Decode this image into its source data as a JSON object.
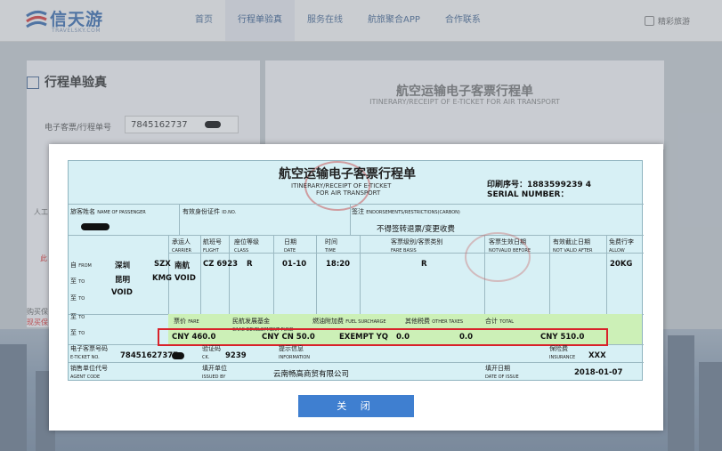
{
  "header": {
    "logo_text": "信天游",
    "logo_sub": "TRAVELSKY.COM",
    "nav": [
      "首页",
      "行程单验真",
      "服务在线",
      "航旅聚合APP",
      "合作联系"
    ],
    "active_nav_index": 1,
    "home_link": "精彩旅游"
  },
  "left_panel": {
    "title": "行程单验真",
    "ticket_label": "电子客票/行程单号",
    "ticket_value": "7845162737",
    "side1": "人工",
    "side2": "此",
    "side3": "购买保",
    "side4": "现买保"
  },
  "right_panel": {
    "title": "航空运输电子客票行程单",
    "subtitle": "ITINERARY/RECEIPT OF E-TICKET FOR AIR TRANSPORT"
  },
  "ticket": {
    "title": "航空运输电子客票行程单",
    "subtitle1": "ITINERARY/RECEIPT OF E-TICKET",
    "subtitle2": "FOR AIR TRANSPORT",
    "print_no": "印刷序号：1883599239    4",
    "serial_no": "SERIAL NUMBER：",
    "passenger_label": "旅客姓名",
    "passenger_label_en": "NAME OF PASSENGER",
    "id_label": "有效身份证件",
    "id_label_en": "ID.NO.",
    "endorse_label": "签注",
    "endorse_label_en": "ENDORSEMENTS/RESTRICTIONS(CARBON)",
    "endorse_value": "不得签转退票/变更收费",
    "headers": {
      "carrier": "承运人",
      "carrier_en": "CARRIER",
      "flight": "航班号",
      "flight_en": "FLIGHT",
      "class": "座位等级",
      "class_en": "CLASS",
      "date": "日期",
      "date_en": "DATE",
      "time": "时间",
      "time_en": "TIME",
      "fare_basis": "客票级别/客票类别",
      "fare_basis_en": "FARE BASIS",
      "nvb": "客票生效日期",
      "nvb_en": "NOTVALID BEFORE",
      "nva": "有效截止日期",
      "nva_en": "NOT VALID AFTER",
      "allow": "免费行李",
      "allow_en": "ALLOW"
    },
    "from_label": "自",
    "from_label_en": "FROM",
    "to_label": "至",
    "to_label_en": "TO",
    "from_city": "深圳",
    "from_code": "SZX",
    "to_city": "昆明",
    "to_code": "KMG",
    "void1": "VOID",
    "void2": "VOID",
    "carrier": "南航",
    "flight": "CZ 6923",
    "class": "R",
    "date": "01-10",
    "time": "18:20",
    "fare_basis": "R",
    "allow": "20KG",
    "fare_label": "票价",
    "fare_label_en": "FARE",
    "cdf_label": "民航发展基金",
    "cdf_label_en": "CAAC DEVELOPMENT FUND",
    "fuel_label": "燃油附加费",
    "fuel_label_en": "FUEL SURCHARGE",
    "other_label": "其他税费",
    "other_label_en": "OTHER TAXES",
    "total_label": "合计",
    "total_label_en": "TOTAL",
    "fare_value": "CNY  460.0",
    "cdf_value": "CNY CN   50.0",
    "fuel_value": "EXEMPT YQ",
    "fuel_amount": "0.0",
    "other_value": "0.0",
    "total_value": "CNY   510.0",
    "eticket_label": "电子客票号码",
    "eticket_label_en": "E-TICKET NO.",
    "eticket_value": "78451627377",
    "ck_label": "验证码",
    "ck_label_en": "CK.",
    "ck_value": "9239",
    "info_label": "提示信息",
    "info_label_en": "INFORMATION",
    "insurance_label": "保险费",
    "insurance_label_en": "INSURANCE",
    "insurance_value": "XXX",
    "agent_label": "销售单位代号",
    "agent_label_en": "AGENT CODE",
    "issuer_label": "填开单位",
    "issuer_label_en": "ISSUED BY",
    "issuer_value": "云南畅高商贸有限公司",
    "issue_date_label": "填开日期",
    "issue_date_label_en": "DATE OF ISSUE",
    "issue_date_value": "2018-01-07"
  },
  "close_button": "关 闭"
}
